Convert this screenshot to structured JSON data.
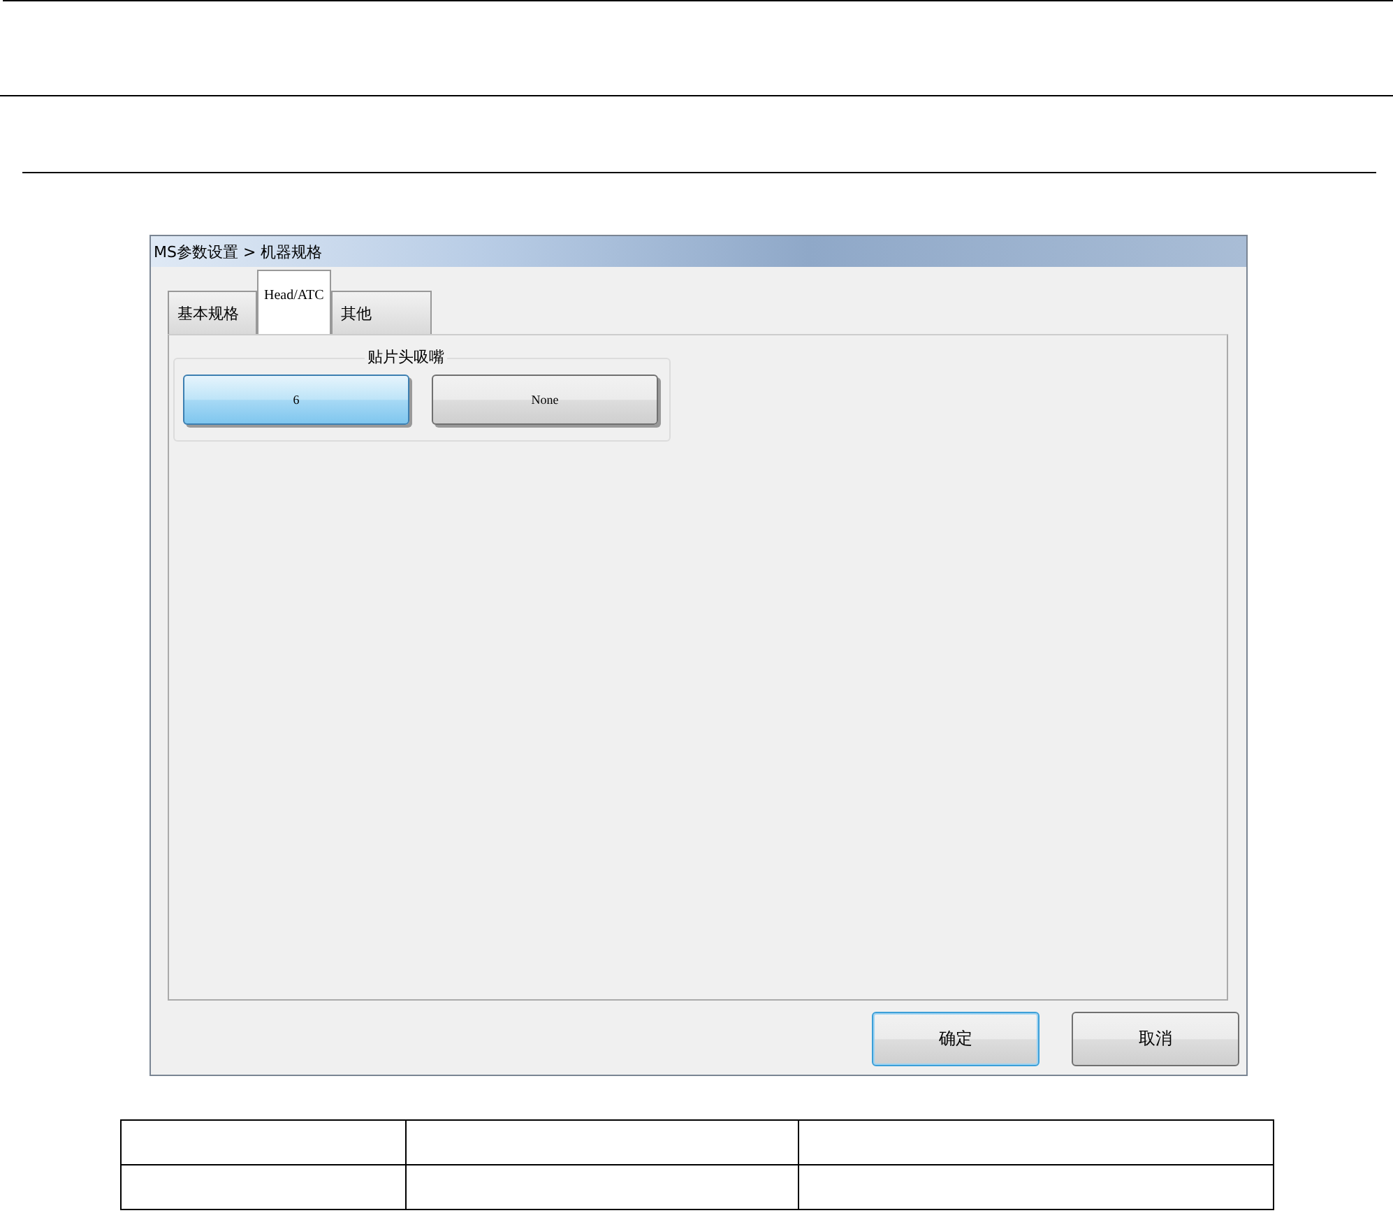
{
  "window": {
    "title": "MS参数设置 > 机器规格"
  },
  "tabs": [
    {
      "label": "基本规格",
      "selected": false
    },
    {
      "label": "Head/ATC",
      "selected": true
    },
    {
      "label": "其他",
      "selected": false
    }
  ],
  "nozzle_group": {
    "title": "贴片头吸嘴",
    "options": [
      {
        "label": "6",
        "selected": true
      },
      {
        "label": "None",
        "selected": false
      }
    ]
  },
  "buttons": [
    {
      "label": "确定",
      "focused": true
    },
    {
      "label": "取消",
      "focused": false
    }
  ]
}
